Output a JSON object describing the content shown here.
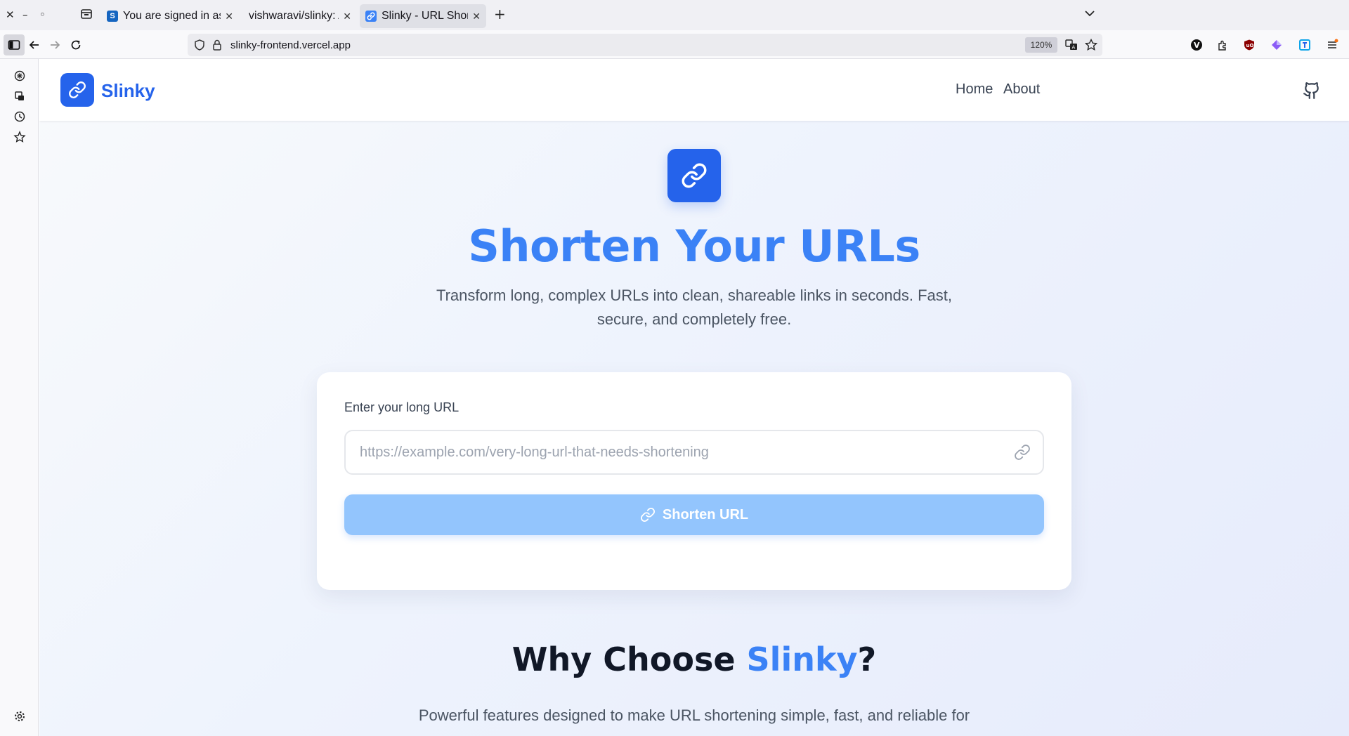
{
  "browser": {
    "tabs": [
      {
        "title": "You are signed in as rojith",
        "active": false
      },
      {
        "title": "vishwaravi/slinky: A simple",
        "active": false
      },
      {
        "title": "Slinky - URL Shortener",
        "active": true
      }
    ],
    "url": "slinky-frontend.vercel.app",
    "zoom": "120%",
    "colors": {
      "chrome": "#f0f0f4",
      "active_tab": "#dfe0e6"
    }
  },
  "site": {
    "brand": "Slinky",
    "nav": {
      "home": "Home",
      "about": "About"
    },
    "hero": {
      "title": "Shorten Your URLs",
      "subtitle": "Transform long, complex URLs into clean, shareable links in seconds. Fast, secure, and completely free."
    },
    "form": {
      "label": "Enter your long URL",
      "placeholder": "https://example.com/very-long-url-that-needs-shortening",
      "value": "",
      "button": "Shorten URL"
    },
    "why": {
      "title_prefix": "Why Choose ",
      "title_highlight": "Slinky",
      "title_suffix": "?",
      "subtitle": "Powerful features designed to make URL shortening simple, fast, and reliable for everyone."
    },
    "colors": {
      "primary": "#2563eb",
      "accent": "#3b82f6",
      "button_disabled": "#93c5fd"
    }
  }
}
